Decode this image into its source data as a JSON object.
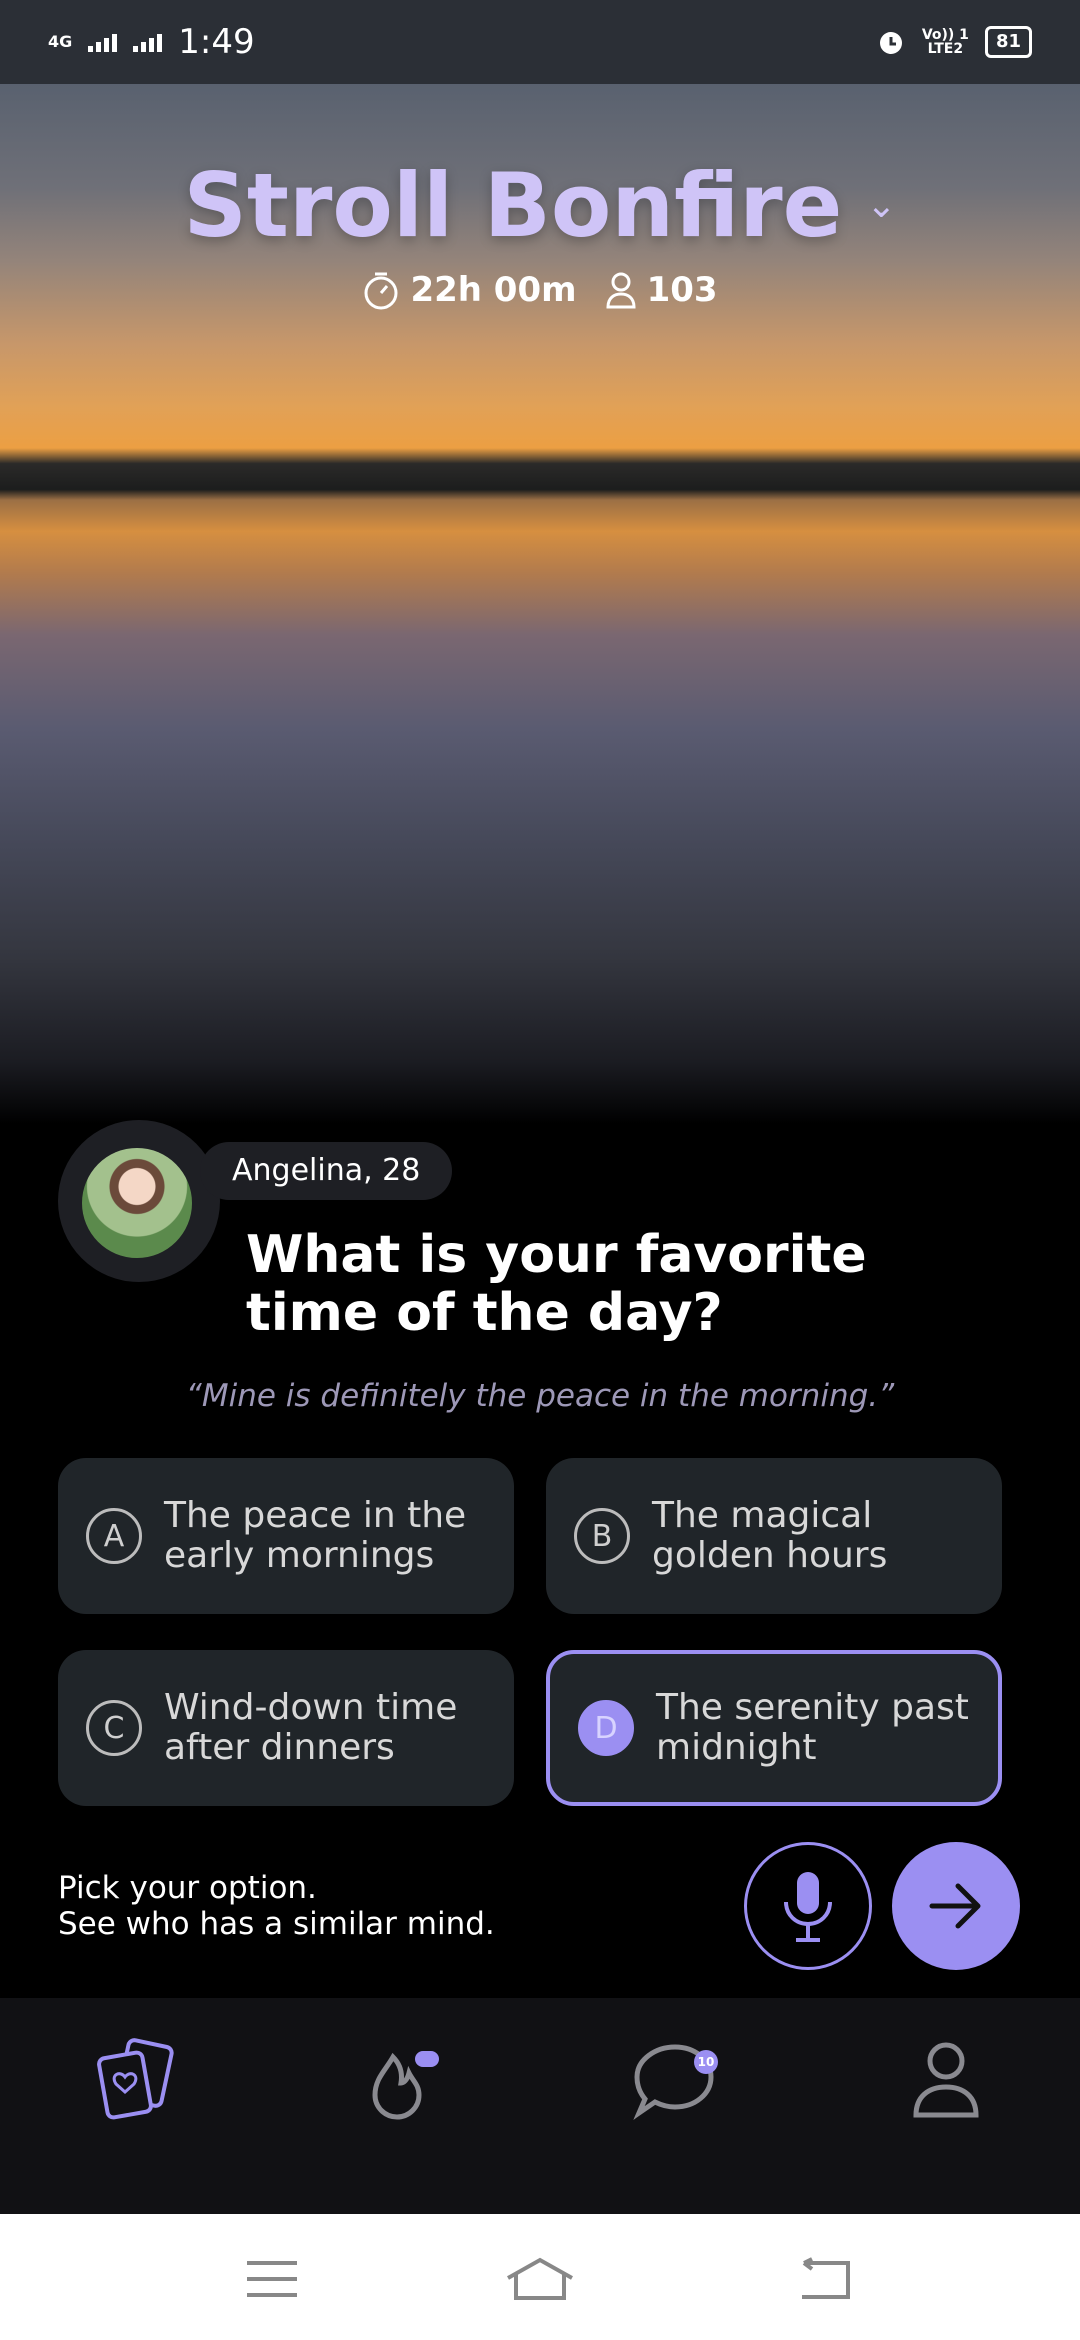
{
  "status_bar": {
    "network": "4G",
    "time": "1:49",
    "volte": "Vo)) 1",
    "lte": "LTE2",
    "battery": "81"
  },
  "header": {
    "title": "Stroll Bonfire",
    "timer": "22h 00m",
    "participants": "103"
  },
  "card": {
    "name_age": "Angelina, 28",
    "question": "What is your favorite time of the day?",
    "quote": "“Mine is definitely the peace in the morning.”"
  },
  "options": [
    {
      "letter": "A",
      "text": "The peace in the early mornings"
    },
    {
      "letter": "B",
      "text": "The magical golden hours"
    },
    {
      "letter": "C",
      "text": "Wind-down time after dinners"
    },
    {
      "letter": "D",
      "text": "The serenity past midnight"
    }
  ],
  "selected_option": "D",
  "hint": {
    "line1": "Pick your option.",
    "line2": "See who has a similar mind."
  },
  "bottom_nav": {
    "items": [
      "cards-icon",
      "bonfire-icon",
      "chat-icon",
      "profile-icon"
    ],
    "chat_badge": "10"
  },
  "colors": {
    "accent": "#9b8ff2",
    "title": "#cfc4f7",
    "option_bg": "#202529"
  }
}
